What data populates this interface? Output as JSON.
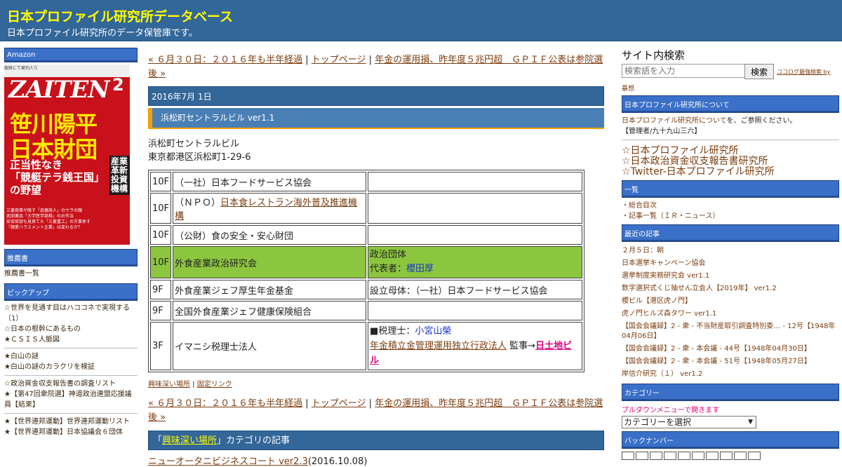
{
  "header": {
    "title": "日本プロファイル研究所データベース",
    "description": "日本プロファイル研究所のデータ保管庫です。"
  },
  "left": {
    "amazon_head": "Amazon",
    "book": {
      "strip": "政財にて発刊人り",
      "brand": "ZAITEN",
      "month": "2",
      "headline1": "笹川陽平",
      "headline2": "日本財団",
      "subline1": "正当性なき",
      "subline2": "「競艇テラ銭王国」",
      "subline3": "の野望",
      "vertical": "産業革新投資機構",
      "fine1": "三菱商事が隠す「武器商人」のウラの顔",
      "fine2": "武田薬品「大学医学部株」のお作法",
      "fine3": "安倍官邸も見捨てた「三菱重工」の万事休す",
      "fine4": "「親愛ハラスメント企業」は変わるか？"
    },
    "recommend_head": "推薦書",
    "recommend_link": "推薦書一覧",
    "pickup_head": "ピックアップ",
    "pickup_group1": [
      "☆世界を見通す目はハココネで実現する（1）",
      "☆日本の根幹にあるもの",
      "★ＣＳＩＳ人脈図"
    ],
    "pickup_group2": [
      "★白山の謎",
      "★白山の謎のカラクリを検証"
    ],
    "pickup_group3": [
      "☆政治資金収支報告書の調査リスト",
      "★【第47回衆院選】神道政治連盟応援議員【結果】"
    ],
    "pickup_group4": [
      "★【世界連邦運動】世界連邦運動リスト",
      "★【世界連邦運動】日本協議会６団体"
    ]
  },
  "center": {
    "nav_prev": "« ６月３０日：２０１６年も半年経過",
    "nav_top": "トップページ",
    "nav_next": "年金の運用損、昨年度５兆円超　ＧＰＩＦ公表は参院選後 »",
    "sep": "|",
    "date": "2016年7月 1日",
    "entry_title": "浜松町セントラルビル ver1.1",
    "address_line1": "浜松町セントラルビル",
    "address_line2": "東京都港区浜松町1-29-6",
    "rows": [
      {
        "floor": "10F",
        "name": "（一社）日本フードサービス協会",
        "desc": ""
      },
      {
        "floor": "10F",
        "name_prefix": "（ＮＰＯ）",
        "name_link": "日本食レストラン海外普及推進機構",
        "desc": ""
      },
      {
        "floor": "10F",
        "name": "（公財）食の安全・安心財団",
        "desc": ""
      },
      {
        "floor": "10F",
        "name": "外食産業政治研究会",
        "desc_line1": "政治団体",
        "desc_label": "代表者：",
        "desc_person": "櫻田厚"
      },
      {
        "floor": "9F",
        "name": "外食産業ジェフ厚生年金基金",
        "desc": "設立母体：（一社）日本フードサービス協会"
      },
      {
        "floor": "9F",
        "name": "全国外食産業ジェフ健康保険組合",
        "desc": ""
      },
      {
        "floor": "3F",
        "name": "イマニシ税理士法人",
        "desc_label": "■税理士：",
        "desc_person": "小宮山榮",
        "desc_link": "年金積立金管理運用独立行政法人",
        "desc_mid": " 監事→",
        "desc_pink": "日土地ビル"
      }
    ],
    "foot_category": "興味深い場所",
    "foot_permalink": "固定リンク",
    "cat_bar_open": "「",
    "cat_bar_link": "興味深い場所",
    "cat_bar_rest": "」カテゴリの記事",
    "article_link": "ニューオータニビジネスコート ver2.3",
    "article_date": "(2016.10.08)"
  },
  "right": {
    "search_title": "サイト内検索",
    "search_placeholder": "検索語を入力",
    "search_button": "検索",
    "search_note": "ココログ最強検索 by",
    "search_note2": "暴想",
    "about_head": "日本プロファイル研究所について",
    "about_link": "日本プロファイル研究所について",
    "about_text": "を、ご参照ください。",
    "about_admin": "【管理者/九十九山三六】",
    "big_links": [
      "☆日本プロファイル研究所",
      "☆日本政治資金収支報告書研究所",
      "☆Twitter-日本プロファイル研究所"
    ],
    "list_head": "一覧",
    "list_items": [
      "・総合目次",
      "・記事一覧（ＩＲ・ニュース）"
    ],
    "recent_head": "最近の記事",
    "recent_items": [
      "２月５日：朝",
      "日本選挙キャンペーン協会",
      "選挙制度実務研究会 ver1.1",
      "数字選択式くじ抽せん立会人【2019年】 ver1.2",
      "櫻ビル【港区虎ノ門】",
      "虎ノ門ヒルズ森タワー ver1.1",
      "【国会会議録】2 - 衆 - 不当財産取引調査特別委… - 12号【1948年04月06日】",
      "【国会会議録】2 - 衆 - 本会議 - 44号【1948年04月30日】",
      "【国会会議録】2 - 衆 - 本会議 - 51号【1948年05月27日】",
      "岸信介研究（１） ver1.2"
    ],
    "category_head": "カテゴリー",
    "category_note": "プルダウンメニューで開きます",
    "category_select": "カテゴリーを選択",
    "backnumber_head": "バックナンバー"
  }
}
